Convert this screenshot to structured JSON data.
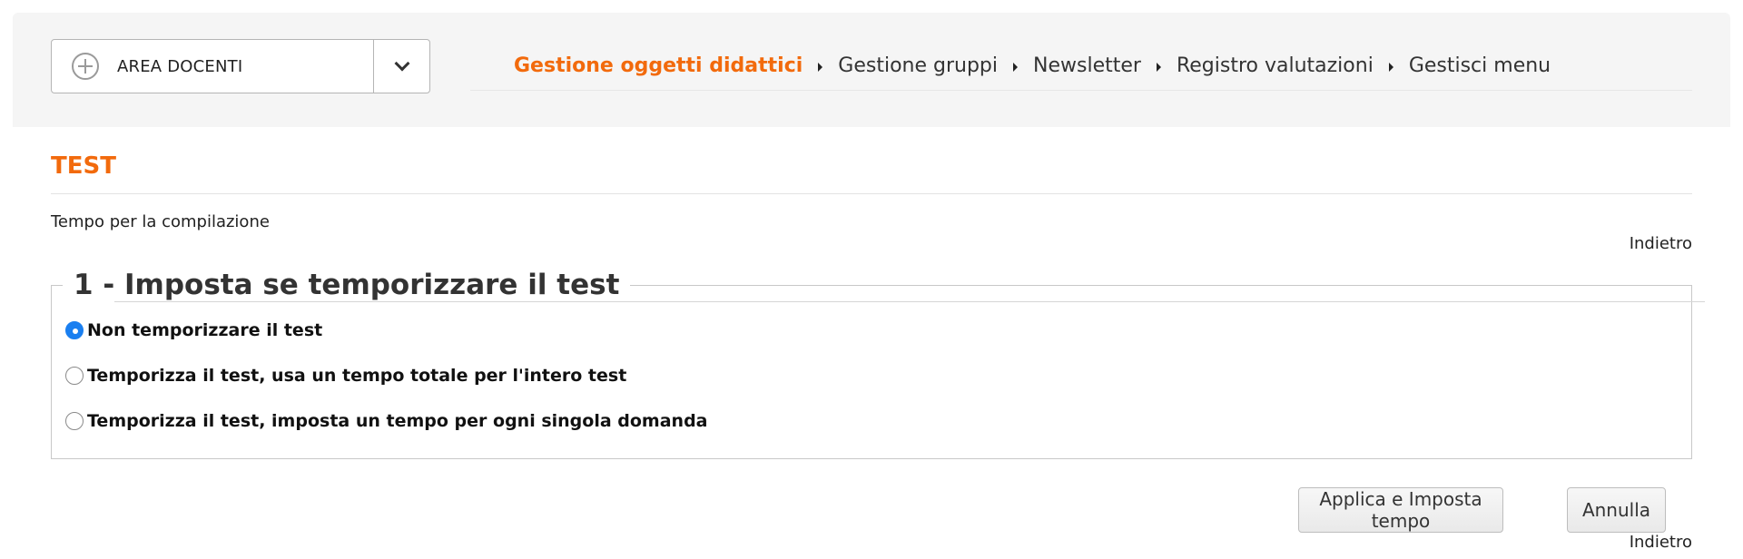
{
  "area_select": {
    "label": "AREA DOCENTI"
  },
  "nav": {
    "items": [
      {
        "label": "Gestione oggetti didattici",
        "active": true
      },
      {
        "label": "Gestione gruppi"
      },
      {
        "label": "Newsletter"
      },
      {
        "label": "Registro valutazioni"
      },
      {
        "label": "Gestisci menu"
      }
    ]
  },
  "page": {
    "title": "TEST",
    "subtitle": "Tempo per la compilazione",
    "back_label": "Indietro"
  },
  "step": {
    "legend": "1 - Imposta se temporizzare il test",
    "selected_index": 0,
    "options": [
      {
        "label": "Non temporizzare il test"
      },
      {
        "label": "Temporizza il test, usa un tempo totale per l'intero test"
      },
      {
        "label": "Temporizza il test, imposta un tempo per ogni singola domanda"
      }
    ]
  },
  "actions": {
    "apply_label": "Applica e Imposta tempo",
    "cancel_label": "Annulla"
  },
  "colors": {
    "accent": "#f26a0c",
    "radio_checked": "#1a7ff0",
    "topbar_bg": "#f5f5f5"
  },
  "icons": {
    "area_select": "plus-circle-icon",
    "dropdown": "chevron-down-icon",
    "nav_separator": "caret-right-icon"
  }
}
